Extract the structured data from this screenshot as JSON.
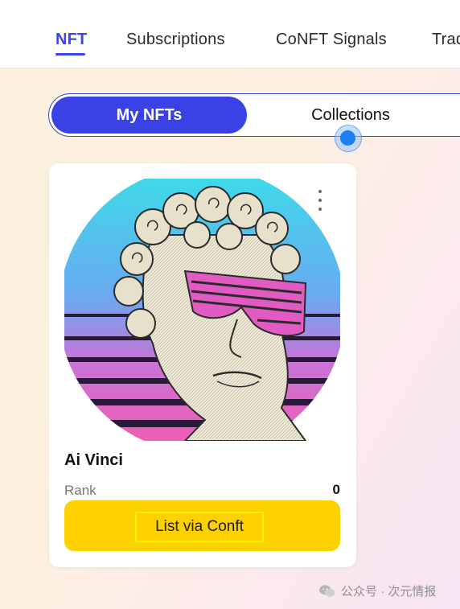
{
  "nav": {
    "tabs": [
      {
        "label": "NFT",
        "active": true
      },
      {
        "label": "Subscriptions"
      },
      {
        "label": "CoNFT Signals"
      },
      {
        "label": "Trad"
      }
    ]
  },
  "segment": {
    "options": [
      "My NFTs",
      "Collections"
    ],
    "selected": "My NFTs"
  },
  "card": {
    "image_icon": "nft-artwork-icon",
    "name": "Ai Vinci",
    "rank_label": "Rank",
    "rank_value": "0",
    "action_label": "List via Conft",
    "more_icon": "more-vertical-icon"
  },
  "watermark": {
    "text": "公众号 · 次元情报"
  },
  "colors": {
    "accent": "#3a42e6",
    "button": "#fdd000",
    "highlight": "#fff200"
  }
}
